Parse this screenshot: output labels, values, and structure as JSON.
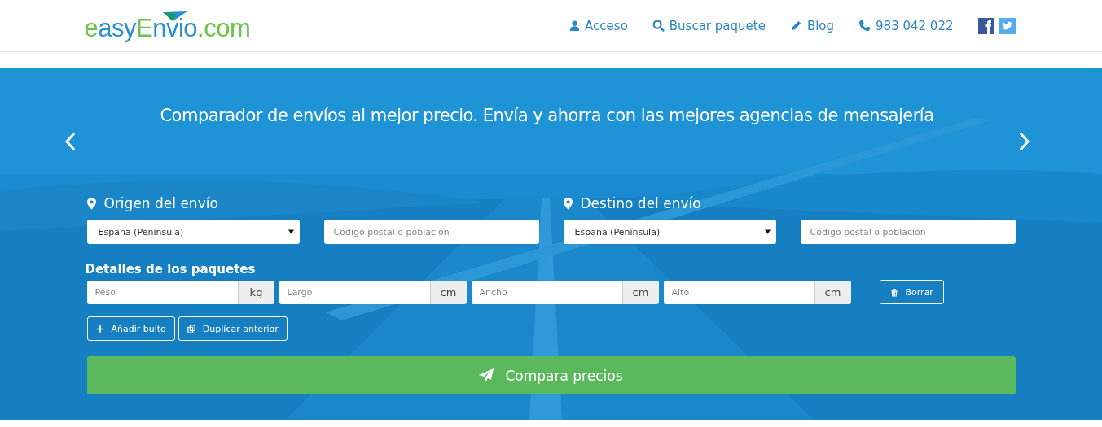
{
  "logo": [
    {
      "text": "e",
      "color": "#6cc24a"
    },
    {
      "text": "asy",
      "color": "#2a8fd0"
    },
    {
      "text": "E",
      "color": "#6cc24a"
    },
    {
      "text": "nvio",
      "color": "#2a8fd0"
    },
    {
      "text": ".com",
      "color": "#6cc24a"
    }
  ],
  "nav": [
    {
      "kind": "user",
      "label": "Acceso"
    },
    {
      "kind": "search",
      "label": "Buscar paquete"
    },
    {
      "kind": "pencil",
      "label": "Blog"
    },
    {
      "kind": "phone",
      "label": "983 042 022"
    }
  ],
  "social": [
    {
      "kind": "facebook"
    },
    {
      "kind": "twitter"
    }
  ],
  "carousel": {
    "headline": "Comparador de envíos al mejor precio. Envía y ahorra con las mejores agencias de mensajería"
  },
  "origin": {
    "heading": "Origen del envío",
    "country": "España (Península)",
    "postcode_placeholder": "Código postal o población"
  },
  "destination": {
    "heading": "Destino del envío",
    "country": "España (Península)",
    "postcode_placeholder": "Código postal o población"
  },
  "packages": {
    "heading": "Detalles de los paquetes",
    "fields": [
      {
        "placeholder": "Peso",
        "unit": "kg"
      },
      {
        "placeholder": "Largo",
        "unit": "cm"
      },
      {
        "placeholder": "Ancho",
        "unit": "cm"
      },
      {
        "placeholder": "Alto",
        "unit": "cm"
      }
    ],
    "delete_button": "Borrar",
    "buttons": [
      {
        "kind": "plus",
        "label": "Añadir bulto"
      },
      {
        "kind": "copy",
        "label": "Duplicar anterior"
      }
    ]
  },
  "submit": "Compara precios"
}
